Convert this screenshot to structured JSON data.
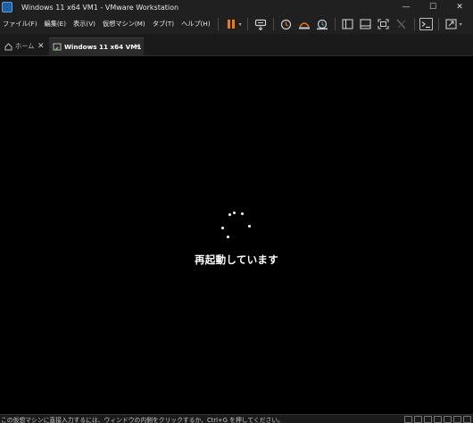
{
  "window": {
    "title": "Windows 11 x64 VM1 - VMware Workstation",
    "minimize_glyph": "—",
    "maximize_glyph": "☐",
    "close_glyph": "✕"
  },
  "menu": {
    "items": [
      {
        "label": "ファイル(F)",
        "name": "menu-file"
      },
      {
        "label": "編集(E)",
        "name": "menu-edit"
      },
      {
        "label": "表示(V)",
        "name": "menu-view"
      },
      {
        "label": "仮想マシン(M)",
        "name": "menu-vm"
      },
      {
        "label": "タブ(T)",
        "name": "menu-tabs"
      },
      {
        "label": "ヘルプ(H)",
        "name": "menu-help"
      }
    ]
  },
  "toolbar": {
    "caret": "▾",
    "accent_color": "#f07a1e",
    "icons": [
      "pause-icon",
      "send-ctrl-alt-del-icon",
      "snapshot-icon",
      "revert-snapshot-icon",
      "snapshot-manager-icon",
      "sidebar-toggle-icon",
      "thumbnail-bar-icon",
      "full-screen-icon",
      "unity-icon",
      "console-icon",
      "stretch-icon"
    ]
  },
  "tabs": {
    "home_label": "ホーム",
    "vm_label": "Windows 11 x64 VM1",
    "close_glyph": "✕"
  },
  "guest": {
    "status_text": "再起動しています",
    "spinner_icon": "loading-spinner-icon"
  },
  "statusbar": {
    "message": "この仮想マシンに直接入力するには、ウィンドウの内側をクリックするか、Ctrl+G を押してください。",
    "icons": [
      "hard-disk-icon",
      "cd-drive-icon",
      "network-icon",
      "usb-icon",
      "sound-icon",
      "display-icon",
      "message-icon"
    ]
  }
}
